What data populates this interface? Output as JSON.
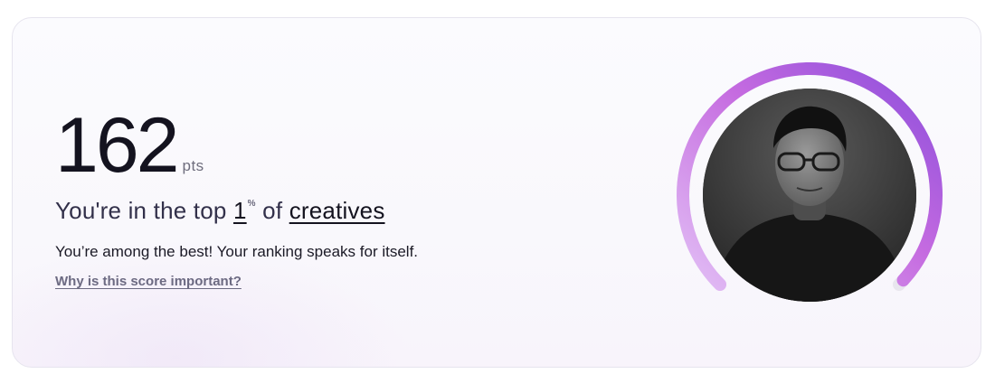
{
  "score": {
    "value": "162",
    "unit": "pts"
  },
  "rank": {
    "prefix": "You're in the top ",
    "percent_value": "1",
    "percent_symbol": "%",
    "of_text": " of ",
    "category": "creatives"
  },
  "description": "You’re among the best! Your ranking speaks for itself.",
  "help_link": "Why is this score important?",
  "progress": {
    "fraction": 0.99,
    "gradient_start": "#e2bff5",
    "gradient_mid": "#c56be0",
    "gradient_end": "#8a4ddb",
    "track_color": "#e8e6ee"
  },
  "avatar": {
    "icon": "profile-photo"
  }
}
